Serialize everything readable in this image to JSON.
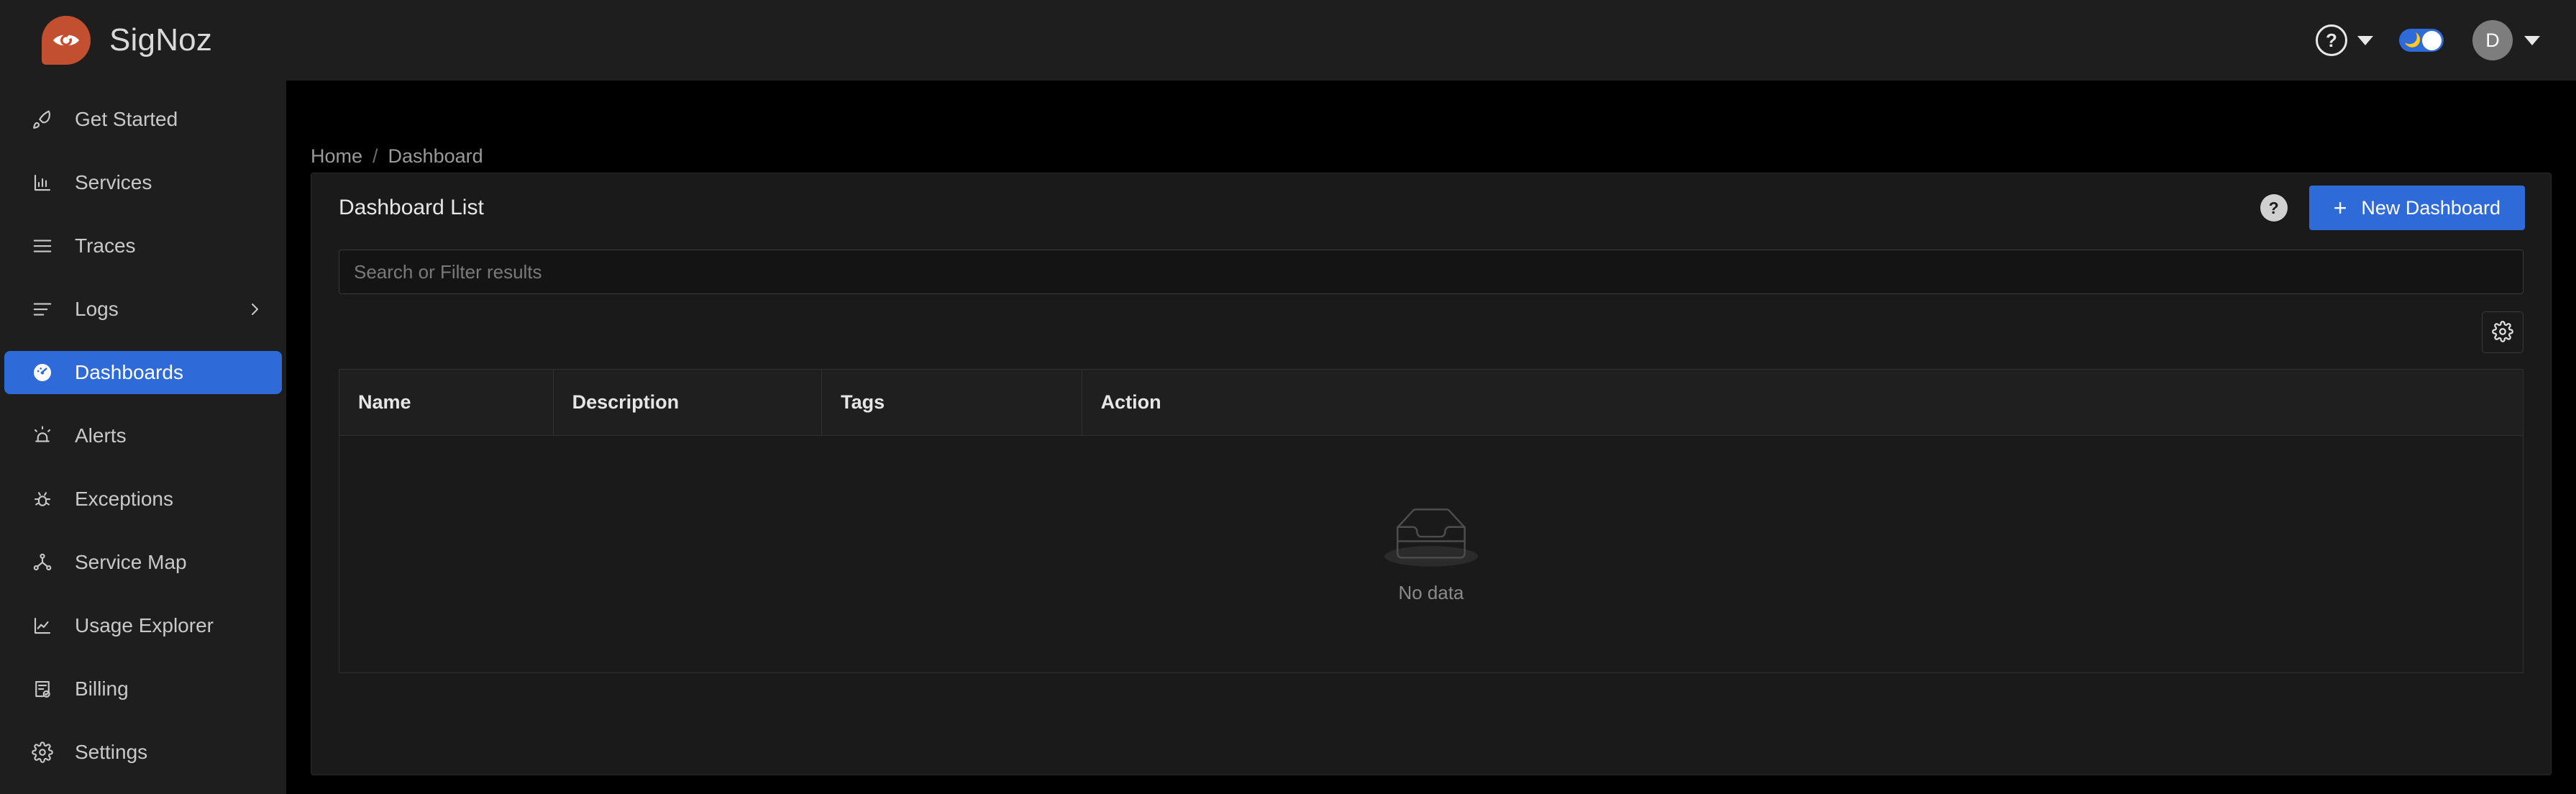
{
  "app": {
    "brand_name": "SigNoz",
    "logo_icon": "signoz-eye-logo"
  },
  "header": {
    "help_icon": "question-circle-icon",
    "help_caret_icon": "caret-down-icon",
    "theme_toggle": {
      "icon": "crescent-moon-icon",
      "glyph": "🌙",
      "state": "dark",
      "color": "#2f6ad9"
    },
    "avatar": {
      "initial": "D",
      "caret_icon": "caret-down-icon",
      "color": "#7d7d7d"
    }
  },
  "sidebar": {
    "items": [
      {
        "label": "Get Started",
        "icon": "rocket-icon",
        "active": false,
        "expandable": false
      },
      {
        "label": "Services",
        "icon": "bar-chart-icon",
        "active": false,
        "expandable": false
      },
      {
        "label": "Traces",
        "icon": "menu-lines-icon",
        "active": false,
        "expandable": false
      },
      {
        "label": "Logs",
        "icon": "logs-lines-icon",
        "active": false,
        "expandable": true
      },
      {
        "label": "Dashboards",
        "icon": "gauge-icon",
        "active": true,
        "expandable": false
      },
      {
        "label": "Alerts",
        "icon": "siren-icon",
        "active": false,
        "expandable": false
      },
      {
        "label": "Exceptions",
        "icon": "bug-icon",
        "active": false,
        "expandable": false
      },
      {
        "label": "Service Map",
        "icon": "network-nodes-icon",
        "active": false,
        "expandable": false
      },
      {
        "label": "Usage Explorer",
        "icon": "line-chart-icon",
        "active": false,
        "expandable": false
      },
      {
        "label": "Billing",
        "icon": "receipt-check-icon",
        "active": false,
        "expandable": false
      },
      {
        "label": "Settings",
        "icon": "gear-icon",
        "active": false,
        "expandable": false
      }
    ],
    "active_color": "#2f6ad9"
  },
  "breadcrumb": {
    "home": "Home",
    "separator": "/",
    "current": "Dashboard"
  },
  "main": {
    "card_title": "Dashboard List",
    "help_badge_icon": "question-mark-icon",
    "new_dashboard_button": {
      "label": "New Dashboard",
      "plus_icon": "plus-icon",
      "color": "#2f6ad9"
    },
    "search": {
      "value": "",
      "placeholder": "Search or Filter results"
    },
    "settings_button_icon": "gear-icon",
    "table": {
      "columns": [
        "Name",
        "Description",
        "Tags",
        "Action"
      ],
      "rows": [],
      "empty_state": {
        "icon": "empty-inbox-icon",
        "label": "No data"
      }
    }
  }
}
